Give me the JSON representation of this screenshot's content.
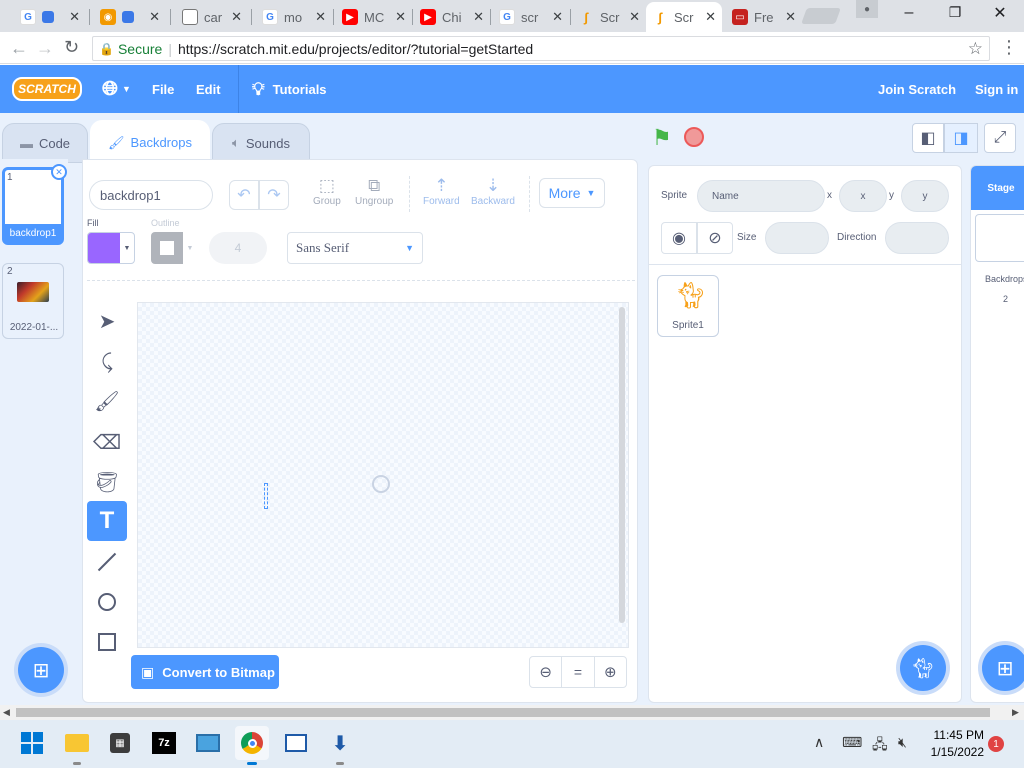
{
  "browser": {
    "tabs": [
      {
        "label": "",
        "icon": "google-g-icon"
      },
      {
        "label": "",
        "icon": "docs-icon"
      },
      {
        "label": "",
        "icon": "scratch-cat-icon"
      },
      {
        "label": "car",
        "icon": "page-icon"
      },
      {
        "label": "mo",
        "icon": "google-g-icon"
      },
      {
        "label": "MC",
        "icon": "youtube-icon"
      },
      {
        "label": "Chi",
        "icon": "youtube-icon"
      },
      {
        "label": "scr",
        "icon": "google-g-icon"
      },
      {
        "label": "Scr",
        "icon": "scratch-icon"
      },
      {
        "label": "Scr",
        "icon": "scratch-icon"
      },
      {
        "label": "Fre",
        "icon": "video-icon"
      }
    ],
    "secure_label": "Secure",
    "url": "https://scratch.mit.edu/projects/editor/?tutorial=getStarted"
  },
  "menu": {
    "logo": "SCRATCH",
    "file": "File",
    "edit": "Edit",
    "tutorials": "Tutorials",
    "join": "Join Scratch",
    "signin": "Sign in"
  },
  "editor_tabs": {
    "code": "Code",
    "backdrops": "Backdrops",
    "sounds": "Sounds"
  },
  "backdrops": [
    {
      "number": "1",
      "label": "backdrop1"
    },
    {
      "number": "2",
      "label": "2022-01-..."
    }
  ],
  "paint": {
    "costume_name": "backdrop1",
    "group": "Group",
    "ungroup": "Ungroup",
    "forward": "Forward",
    "backward": "Backward",
    "more": "More",
    "fill_label": "Fill",
    "outline_label": "Outline",
    "outline_width": "4",
    "font": "Sans Serif",
    "convert": "Convert to Bitmap",
    "fill_color": "#9966ff",
    "zoom_reset": "="
  },
  "sprite_info": {
    "sprite_label": "Sprite",
    "name_placeholder": "Name",
    "x_label": "x",
    "y_label": "y",
    "x_placeholder": "x",
    "y_placeholder": "y",
    "size_label": "Size",
    "direction_label": "Direction"
  },
  "sprites": [
    {
      "label": "Sprite1"
    }
  ],
  "stage": {
    "title": "Stage",
    "backdrops_label": "Backdrops",
    "count": "2"
  },
  "taskbar": {
    "time": "11:45 PM",
    "date": "1/15/2022",
    "notifications": "1",
    "sevenzip": "7z"
  }
}
